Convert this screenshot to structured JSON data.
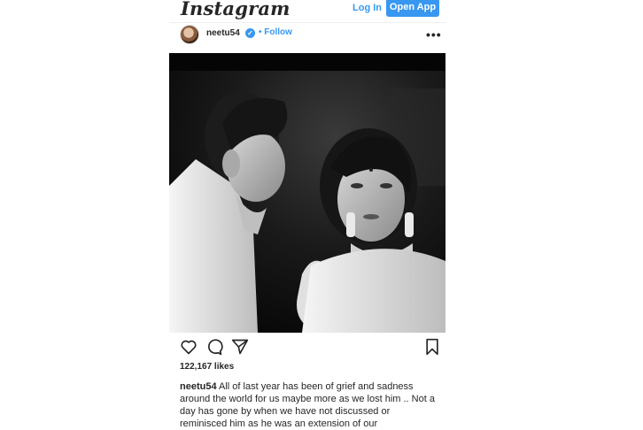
{
  "header": {
    "logo_text": "Instagram",
    "login_label": "Log In",
    "open_app_label": "Open App"
  },
  "post": {
    "username": "neetu54",
    "verified_icon": "verified-badge-icon",
    "follow_label": "• Follow",
    "more_icon": "ellipsis-icon",
    "more_glyph": "•••",
    "photo_description_icon": "black-and-white-couple-photo",
    "actions": {
      "like_icon": "heart-icon",
      "comment_icon": "comment-icon",
      "share_icon": "paper-plane-icon",
      "save_icon": "bookmark-icon"
    },
    "likes_text": "122,167 likes",
    "caption_user": "neetu54",
    "caption_text": " All of last year has been of grief and sadness around the world for us maybe more as we lost him .. Not a day has gone by when we have not discussed or reminisced him as he was an extension of our"
  },
  "colors": {
    "accent": "#3897f0",
    "text": "#262626"
  }
}
